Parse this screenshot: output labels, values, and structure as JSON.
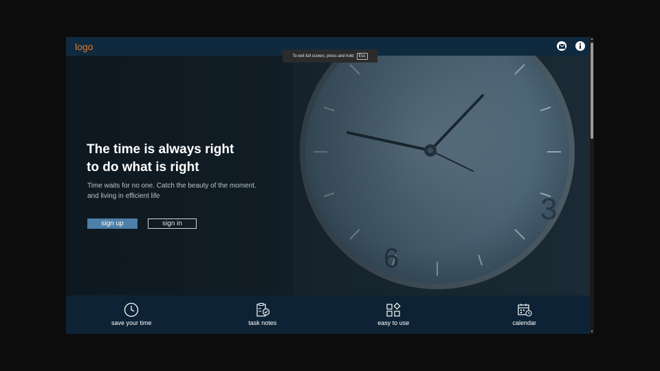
{
  "header": {
    "logo": "logo",
    "mail_icon": "mail-icon",
    "info_icon": "info-icon"
  },
  "fullscreen_notice": {
    "text": "To exit full screen, press and hold",
    "key": "Esc"
  },
  "hero": {
    "headline_line1": "The time is always right",
    "headline_line2": "to do what is right",
    "subtext_line1": "Time waits for no one. Catch the beauty of the moment.",
    "subtext_line2": "and living in efficient life",
    "signup_label": "sign up",
    "signin_label": "sign in"
  },
  "features": [
    {
      "label": "save your time",
      "icon": "clock-icon"
    },
    {
      "label": "task notes",
      "icon": "clipboard-check-icon"
    },
    {
      "label": "easy to use",
      "icon": "apps-grid-icon"
    },
    {
      "label": "calendar",
      "icon": "calendar-icon"
    }
  ],
  "colors": {
    "accent_logo": "#e07a2a",
    "primary_button": "#4e7fa8",
    "top_bar": "#0f2a3e",
    "feature_bar": "#0d2335"
  }
}
